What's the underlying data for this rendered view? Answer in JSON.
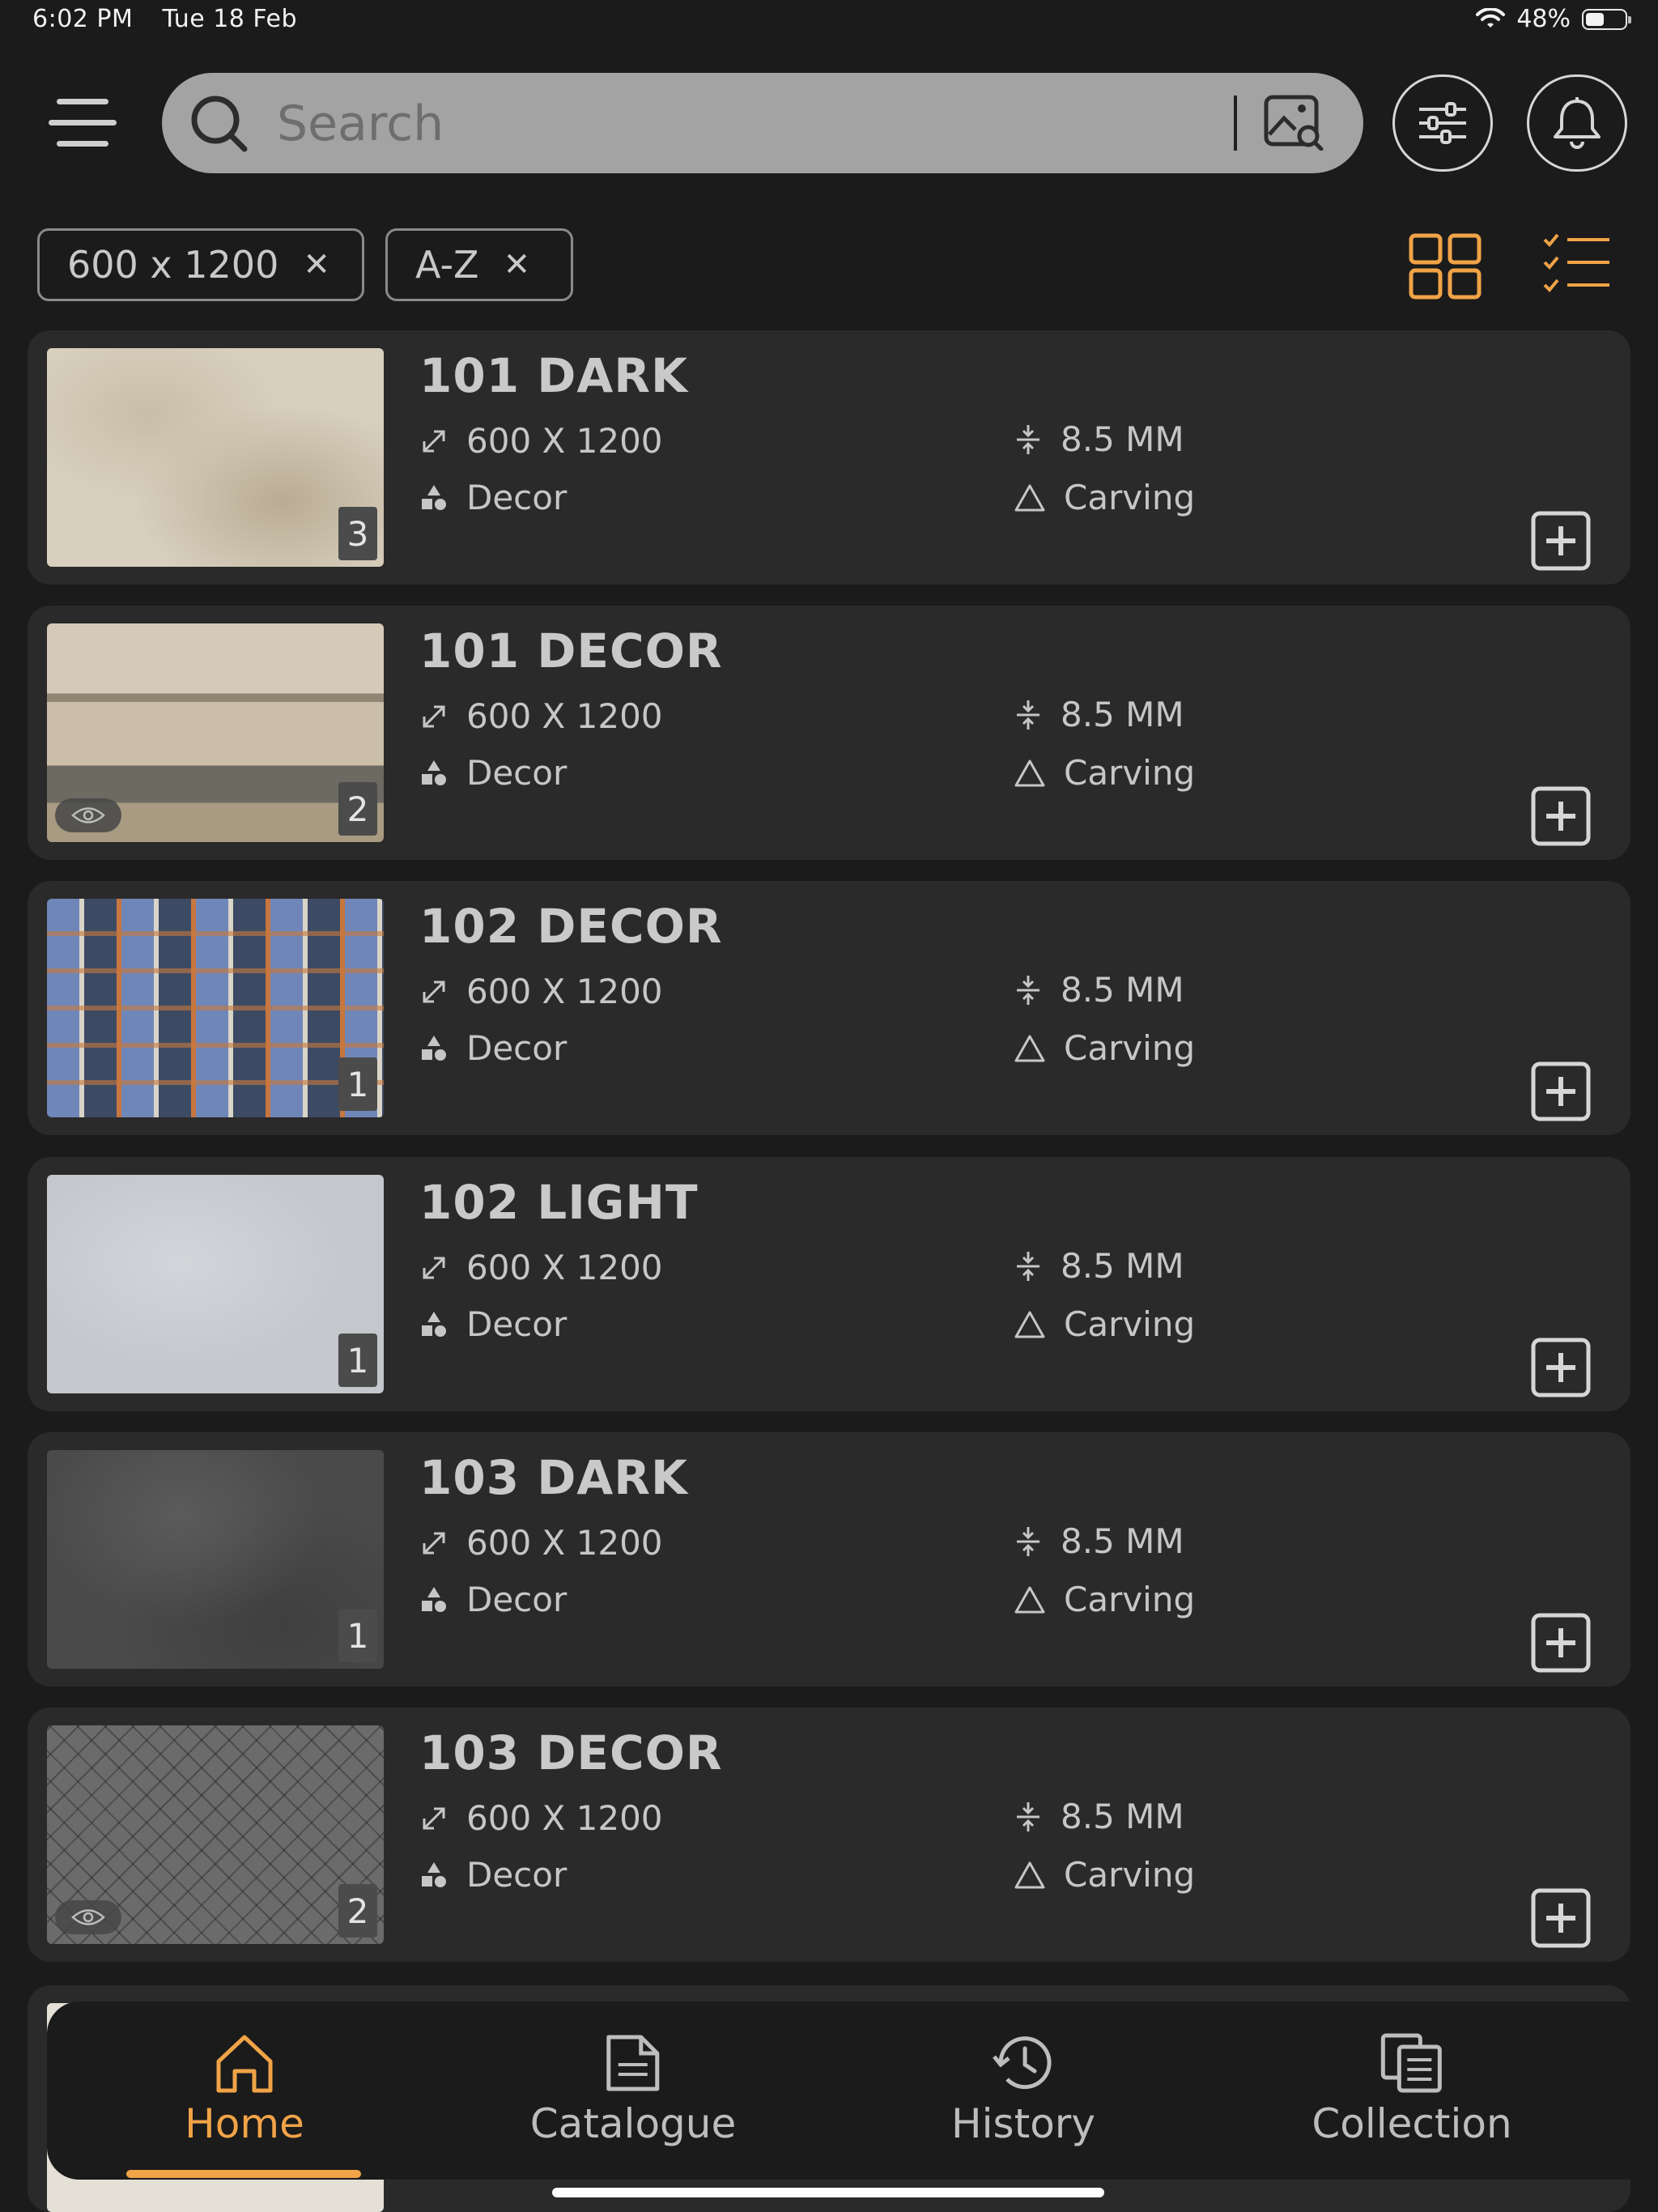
{
  "status_bar": {
    "time": "6:02 PM",
    "date": "Tue 18 Feb",
    "battery": "48%",
    "battery_level": 0.48
  },
  "header": {
    "search": {
      "placeholder": "Search"
    }
  },
  "filters": {
    "chips": [
      {
        "label": "600 x 1200"
      },
      {
        "label": "A-Z"
      }
    ]
  },
  "colors": {
    "accent": "#f0a347",
    "background": "#1b1b1b",
    "card": "#2a2a2a"
  },
  "products": [
    {
      "name": "101 DARK",
      "size": "600 X 1200",
      "thickness": "8.5 MM",
      "category": "Decor",
      "finish": "Carving",
      "count": "3",
      "preview": false
    },
    {
      "name": "101 DECOR",
      "size": "600 X 1200",
      "thickness": "8.5 MM",
      "category": "Decor",
      "finish": "Carving",
      "count": "2",
      "preview": true
    },
    {
      "name": "102 DECOR",
      "size": "600 X 1200",
      "thickness": "8.5 MM",
      "category": "Decor",
      "finish": "Carving",
      "count": "1",
      "preview": false
    },
    {
      "name": "102 LIGHT",
      "size": "600 X 1200",
      "thickness": "8.5 MM",
      "category": "Decor",
      "finish": "Carving",
      "count": "1",
      "preview": false
    },
    {
      "name": "103 DARK",
      "size": "600 X 1200",
      "thickness": "8.5 MM",
      "category": "Decor",
      "finish": "Carving",
      "count": "1",
      "preview": false
    },
    {
      "name": "103 DECOR",
      "size": "600 X 1200",
      "thickness": "8.5 MM",
      "category": "Decor",
      "finish": "Carving",
      "count": "2",
      "preview": true
    }
  ],
  "bottom_nav": {
    "items": [
      {
        "label": "Home",
        "icon": "home-icon",
        "active": true
      },
      {
        "label": "Catalogue",
        "icon": "document-icon",
        "active": false
      },
      {
        "label": "History",
        "icon": "history-icon",
        "active": false
      },
      {
        "label": "Collection",
        "icon": "collection-icon",
        "active": false
      }
    ]
  }
}
